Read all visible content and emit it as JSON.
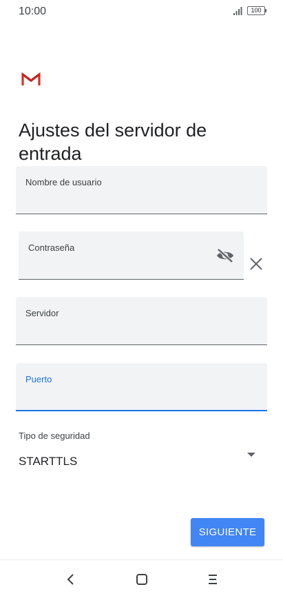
{
  "status_bar": {
    "time": "10:00",
    "battery": "100"
  },
  "title": "Ajustes del servidor de entrada",
  "fields": {
    "username": {
      "label": "Nombre de usuario",
      "value": ""
    },
    "password": {
      "label": "Contraseña",
      "value": ""
    },
    "server": {
      "label": "Servidor",
      "value": ""
    },
    "port": {
      "label": "Puerto",
      "value": ""
    }
  },
  "security": {
    "label": "Tipo de seguridad",
    "value": "STARTTLS"
  },
  "next_button": "SIGUIENTE",
  "colors": {
    "accent": "#1a73e8",
    "button": "#4285f4",
    "gmail_red": "#d93025"
  },
  "icons": [
    "gmail-logo",
    "visibility-off-icon",
    "close-icon",
    "dropdown-arrow-icon",
    "back-icon",
    "home-icon",
    "menu-icon"
  ]
}
